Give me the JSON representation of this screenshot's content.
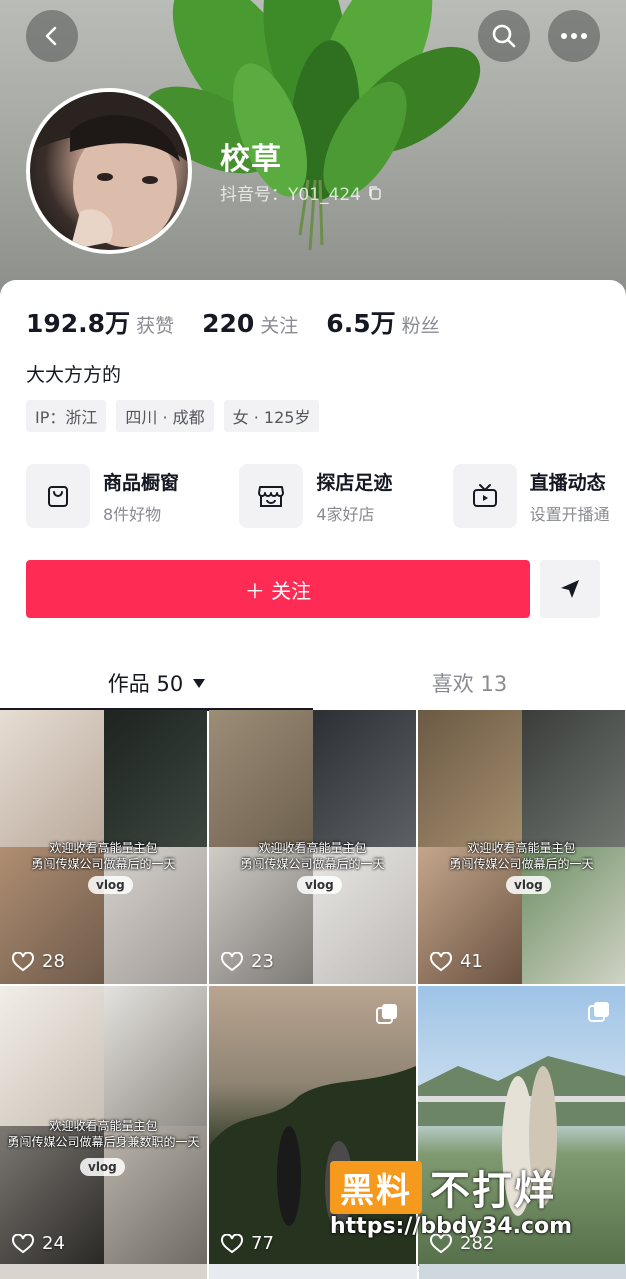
{
  "profile": {
    "name": "校草",
    "handle": "抖音号：Y01_424",
    "bio": "大大方方的"
  },
  "stats": [
    {
      "value": "192.8万",
      "label": "获赞"
    },
    {
      "value": "220",
      "label": "关注"
    },
    {
      "value": "6.5万",
      "label": "粉丝"
    }
  ],
  "tags": [
    "IP：浙江",
    "四川 · 成都",
    "女 · 125岁"
  ],
  "services": [
    {
      "title": "商品橱窗",
      "subtitle": "8件好物",
      "icon": "bag-icon"
    },
    {
      "title": "探店足迹",
      "subtitle": "4家好店",
      "icon": "shop-icon"
    },
    {
      "title": "直播动态",
      "subtitle": "设置开播通",
      "icon": "tv-icon"
    }
  ],
  "actions": {
    "follow": "＋ 关注"
  },
  "tabs": {
    "works": "作品 50",
    "likes": "喜欢 13"
  },
  "videos": [
    {
      "likes": "28",
      "caption": "欢迎收看高能量主包\n勇闯传媒公司做幕后的一天",
      "badge": "vlog"
    },
    {
      "likes": "23",
      "caption": "欢迎收看高能量主包\n勇闯传媒公司做幕后的一天",
      "badge": "vlog"
    },
    {
      "likes": "41",
      "caption": "欢迎收看高能量主包\n勇闯传媒公司做幕后的一天",
      "badge": "vlog"
    },
    {
      "likes": "24",
      "caption": "欢迎收看高能量主包\n勇闯传媒公司做幕后身兼数职的一天",
      "badge": "vlog"
    },
    {
      "likes": "77"
    },
    {
      "likes": "282"
    }
  ],
  "watermark": {
    "box": "黑料",
    "text": "不打烊",
    "url": "https://bbdy34.com"
  },
  "colors": {
    "accent": "#fe2c55",
    "text": "#161823",
    "muted": "#8a8b91"
  }
}
